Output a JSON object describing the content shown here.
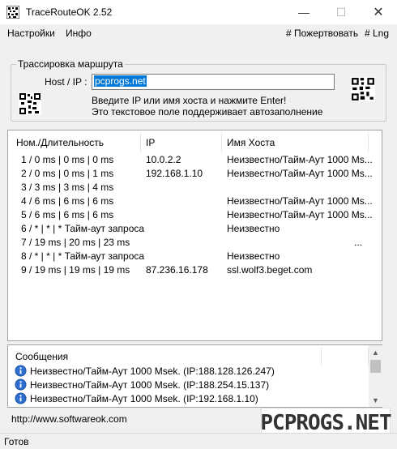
{
  "window": {
    "title": "TraceRouteOK 2.52",
    "min_glyph": "—",
    "max_glyph": "☐",
    "close_glyph": "✕"
  },
  "menu": {
    "settings": "Настройки",
    "info": "Инфо",
    "donate": "# Пожертвовать",
    "language": "# Lng"
  },
  "trace": {
    "group_title": "Трассировка маршрута",
    "host_label": "Host / IP :",
    "host_value": "pcprogs.net",
    "hint_line1": "Введите IP или имя хоста и нажмите Enter!",
    "hint_line2": "Это текстовое поле поддерживает автозаполнение"
  },
  "table": {
    "columns": [
      "Ном./Длительность",
      "IP",
      "Имя Хоста"
    ],
    "rows": [
      {
        "hop": "1 / 0 ms | 0 ms | 0 ms",
        "ip": "10.0.2.2",
        "host": "Неизвестно/Тайм-Аут 1000 Ms..."
      },
      {
        "hop": "2 / 0 ms | 0 ms | 1 ms",
        "ip": "192.168.1.10",
        "host": "Неизвестно/Тайм-Аут 1000 Ms..."
      },
      {
        "hop": "3 / 3 ms | 3 ms | 4 ms",
        "ip": "",
        "host": ""
      },
      {
        "hop": "4 / 6 ms | 6 ms | 6 ms",
        "ip": "",
        "host": "Неизвестно/Тайм-Аут 1000 Ms..."
      },
      {
        "hop": "5 / 6 ms | 6 ms | 6 ms",
        "ip": "",
        "host": "Неизвестно/Тайм-Аут 1000 Ms..."
      },
      {
        "hop": "6 / * | * | * Тайм-аут запроса",
        "ip": "",
        "host": "Неизвестно"
      },
      {
        "hop": "7 / 19 ms | 20 ms | 23 ms",
        "ip": "",
        "host": "..."
      },
      {
        "hop": "8 / * | * | * Тайм-аут запроса",
        "ip": "",
        "host": "Неизвестно"
      },
      {
        "hop": "9 / 19 ms | 19 ms | 19 ms",
        "ip": "87.236.16.178",
        "host": "ssl.wolf3.beget.com"
      }
    ]
  },
  "messages": {
    "title": "Сообщения",
    "items": [
      "Неизвестно/Тайм-Аут 1000 Msek. (IP:188.128.126.247)",
      "Неизвестно/Тайм-Аут 1000 Msek. (IP:188.254.15.137)",
      "Неизвестно/Тайм-Аут 1000 Msek. (IP:192.168.1.10)"
    ]
  },
  "footer": {
    "website": "http://www.softwareok.com",
    "status": "Готов",
    "watermark": "PCPROGS.NET"
  }
}
